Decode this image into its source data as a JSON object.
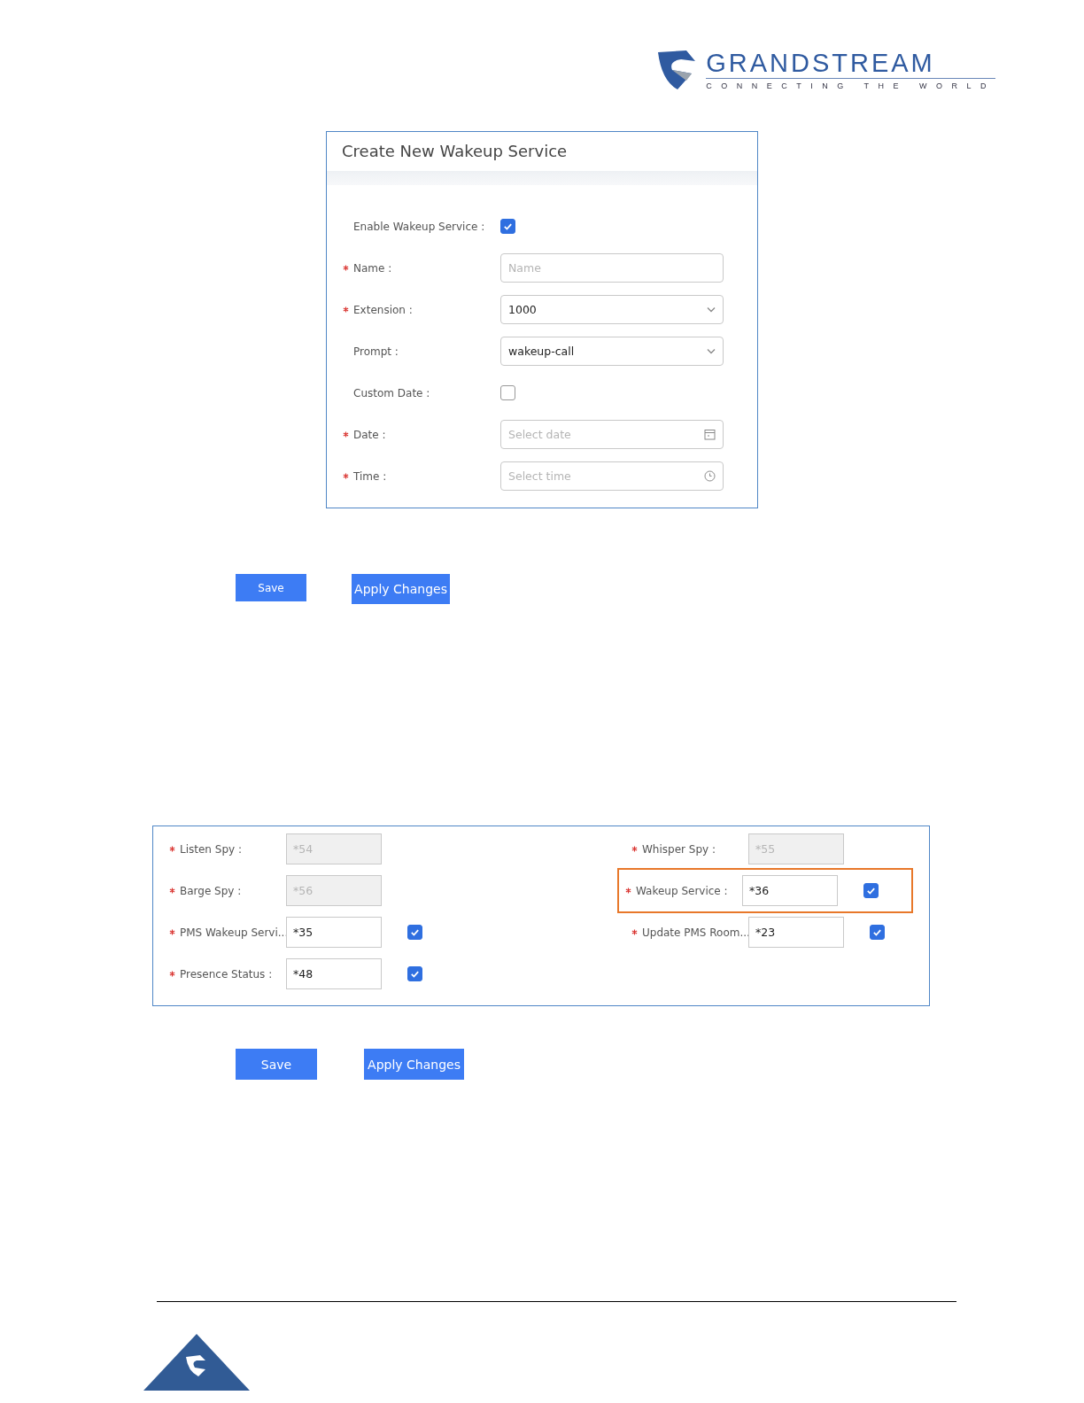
{
  "header": {
    "brand": "GRANDSTREAM",
    "tagline": "CONNECTING THE WORLD"
  },
  "dialog": {
    "title": "Create New Wakeup Service",
    "fields": [
      {
        "kind": "checkbox",
        "label": "Enable Wakeup Service :",
        "required": false,
        "checked": true
      },
      {
        "kind": "text",
        "label": "Name :",
        "required": true,
        "placeholder": "Name"
      },
      {
        "kind": "select",
        "label": "Extension :",
        "required": true,
        "value": "1000"
      },
      {
        "kind": "select",
        "label": "Prompt :",
        "required": false,
        "value": "wakeup-call"
      },
      {
        "kind": "checkbox",
        "label": "Custom Date :",
        "required": false,
        "checked": false
      },
      {
        "kind": "date",
        "label": "Date :",
        "required": true,
        "placeholder": "Select date"
      },
      {
        "kind": "time",
        "label": "Time :",
        "required": true,
        "placeholder": "Select time"
      }
    ]
  },
  "dialog_buttons": [
    "Save",
    "Apply Changes"
  ],
  "feature_codes": [
    {
      "label": "Listen Spy :",
      "required": true,
      "value": "*54",
      "disabled": true,
      "highlighted": false
    },
    {
      "label": "Whisper Spy :",
      "required": true,
      "value": "*55",
      "disabled": true,
      "highlighted": false
    },
    {
      "label": "Barge Spy :",
      "required": true,
      "value": "*56",
      "disabled": true,
      "highlighted": false
    },
    {
      "label": "Wakeup Service :",
      "required": true,
      "value": "*36",
      "disabled": false,
      "checked": true,
      "highlighted": true
    },
    {
      "label": "PMS Wakeup Servi...",
      "required": true,
      "value": "*35",
      "disabled": false,
      "checked": true,
      "highlighted": false
    },
    {
      "label": "Update PMS Room...",
      "required": true,
      "value": "*23",
      "disabled": false,
      "checked": true,
      "highlighted": false
    },
    {
      "label": "Presence Status :",
      "required": true,
      "value": "*48",
      "disabled": false,
      "checked": true,
      "highlighted": false
    }
  ],
  "feature_buttons": [
    "Save",
    "Apply Changes"
  ]
}
